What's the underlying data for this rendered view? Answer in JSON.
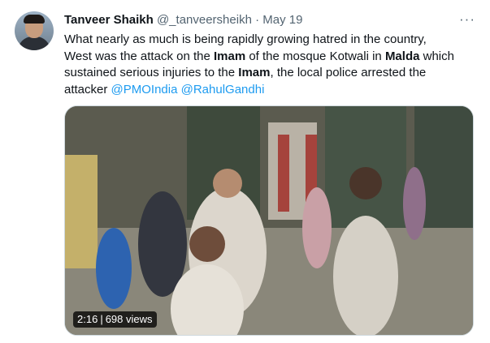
{
  "tweet": {
    "author_name": "Tanveer Shaikh",
    "author_handle": "@_tanveersheikh",
    "separator": "·",
    "date": "May 19",
    "more_icon": "more-icon",
    "text_lines": [
      [
        {
          "t": "What nearly as much is being rapidly growing hatred in the country,"
        }
      ],
      [
        {
          "t": " West was the attack on the "
        },
        {
          "t": "Imam",
          "b": true
        },
        {
          "t": " of the mosque Kotwali in "
        },
        {
          "t": "Malda",
          "b": true
        },
        {
          "t": " which"
        }
      ],
      [
        {
          "t": "sustained serious injuries to the "
        },
        {
          "t": "Imam",
          "b": true
        },
        {
          "t": ", the local police arrested the"
        }
      ],
      [
        {
          "t": "attacker "
        },
        {
          "t": "@PMOIndia",
          "m": true
        },
        {
          "t": " "
        },
        {
          "t": "@RahulGandhi",
          "m": true
        }
      ]
    ],
    "video": {
      "duration": "2:16",
      "views": "698 views"
    }
  },
  "colors": {
    "link": "#1d9bf0",
    "secondary_text": "#536471",
    "primary_text": "#0f1419"
  }
}
